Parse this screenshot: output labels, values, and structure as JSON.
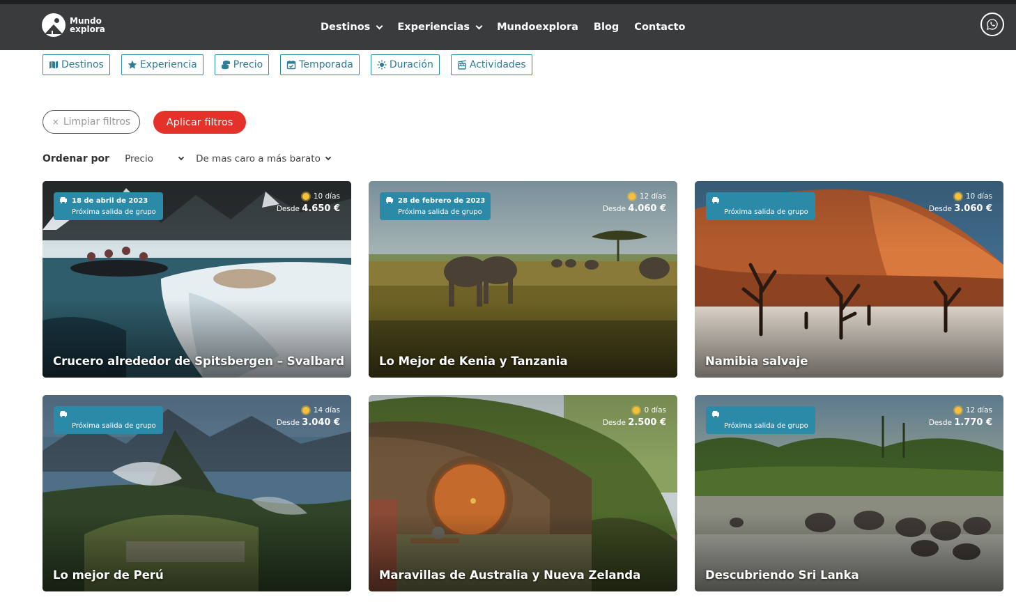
{
  "header": {
    "logo_line1": "Mundo",
    "logo_line2": "explora",
    "nav": [
      {
        "label": "Destinos",
        "dropdown": true
      },
      {
        "label": "Experiencias",
        "dropdown": true
      },
      {
        "label": "Mundoexplora",
        "dropdown": false
      },
      {
        "label": "Blog",
        "dropdown": false
      },
      {
        "label": "Contacto",
        "dropdown": false
      }
    ],
    "whatsapp_icon": "whatsapp-icon"
  },
  "filters": [
    {
      "label": "Destinos",
      "icon": "map-icon"
    },
    {
      "label": "Experiencia",
      "icon": "star-icon"
    },
    {
      "label": "Precio",
      "icon": "coins-icon"
    },
    {
      "label": "Temporada",
      "icon": "calendar-icon"
    },
    {
      "label": "Duración",
      "icon": "sun-icon"
    },
    {
      "label": "Actividades",
      "icon": "gondola-icon"
    }
  ],
  "actions": {
    "clear_label": "Limpiar filtros",
    "apply_label": "Aplicar filtros"
  },
  "sort": {
    "label": "Ordenar por",
    "field": "Precio",
    "order": "De mas caro a más barato"
  },
  "colors": {
    "accent": "#2b8aa8",
    "primary_button": "#e4322b",
    "navbar": "#3a3b3c"
  },
  "cards": [
    {
      "title": "Crucero alrededor de Spitsbergen – Svalbard",
      "date": "18 de abril de 2023",
      "badge": "Próxima salida de grupo",
      "days": "10 días",
      "price_prefix": "Desde",
      "price": "4.650 €"
    },
    {
      "title": "Lo Mejor de Kenia y Tanzania",
      "date": "28 de febrero de 2023",
      "badge": "Próxima salida de grupo",
      "days": "12 días",
      "price_prefix": "Desde",
      "price": "4.060 €"
    },
    {
      "title": "Namibia salvaje",
      "date": "",
      "badge": "Próxima salida de grupo",
      "days": "10 días",
      "price_prefix": "Desde",
      "price": "3.060 €"
    },
    {
      "title": "Lo mejor de Perú",
      "date": "",
      "badge": "Próxima salida de grupo",
      "days": "14 días",
      "price_prefix": "Desde",
      "price": "3.040 €"
    },
    {
      "title": "Maravillas de Australia y Nueva Zelanda",
      "date": "",
      "badge": "",
      "days": "0 días",
      "price_prefix": "Desde",
      "price": "2.500 €"
    },
    {
      "title": "Descubriendo Sri Lanka",
      "date": "",
      "badge": "Próxima salida de grupo",
      "days": "12 días",
      "price_prefix": "Desde",
      "price": "1.770 €"
    }
  ]
}
